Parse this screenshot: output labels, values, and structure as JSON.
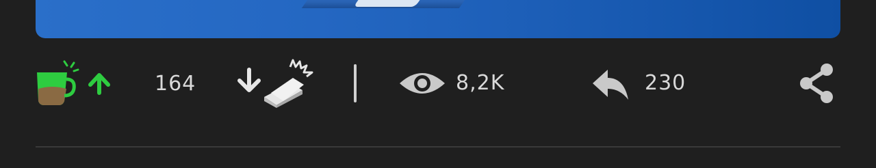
{
  "post": {
    "media": {
      "image_alt_icon": "image-preview"
    },
    "actions": {
      "upvote": {
        "count": "164",
        "icon": "coffee-cup-arrow-up-icon",
        "color": "#2ecc40"
      },
      "downvote": {
        "icon": "arrow-down-box-icon"
      },
      "views": {
        "count": "8,2K",
        "icon": "eye-icon"
      },
      "replies": {
        "count": "230",
        "icon": "reply-icon"
      },
      "share": {
        "icon": "share-icon"
      }
    }
  }
}
